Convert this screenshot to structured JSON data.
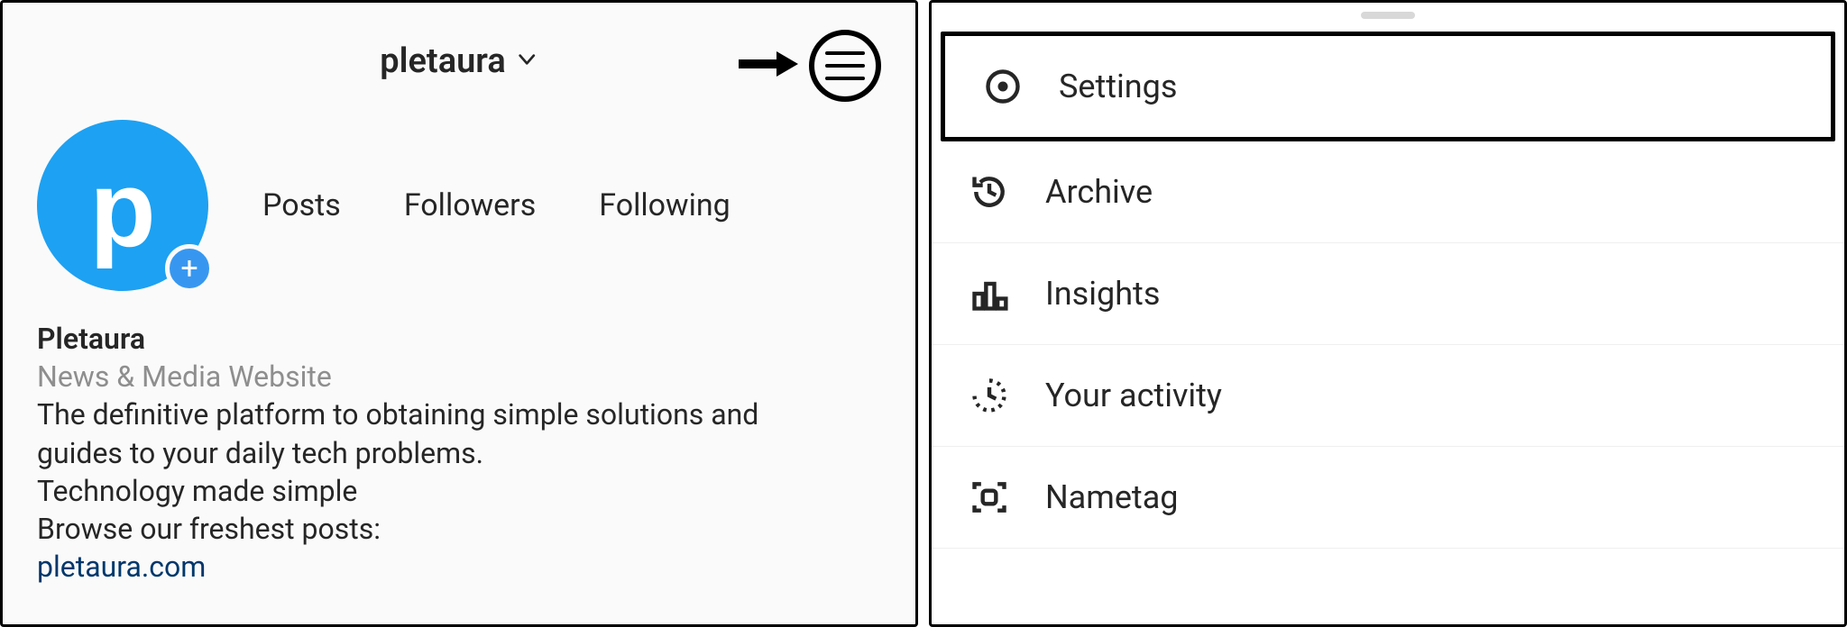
{
  "profile": {
    "username": "pletaura",
    "avatar_letter": "p",
    "stats": {
      "posts_label": "Posts",
      "followers_label": "Followers",
      "following_label": "Following"
    },
    "bio": {
      "display_name": "Pletaura",
      "category": "News & Media Website",
      "line1": "The definitive platform to obtaining simple solutions and",
      "line2": "guides to your daily tech problems.",
      "line3": "Technology made simple",
      "line4": "Browse our freshest posts:",
      "link": "pletaura.com"
    }
  },
  "menu": {
    "items": [
      {
        "icon": "gear-icon",
        "label": "Settings",
        "highlight": true
      },
      {
        "icon": "history-icon",
        "label": "Archive"
      },
      {
        "icon": "barchart-icon",
        "label": "Insights"
      },
      {
        "icon": "activity-icon",
        "label": "Your activity"
      },
      {
        "icon": "nametag-icon",
        "label": "Nametag"
      }
    ]
  }
}
